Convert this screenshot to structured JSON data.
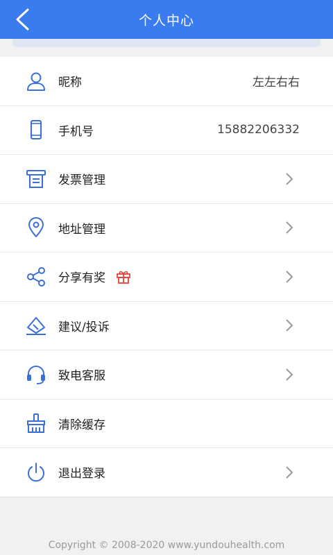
{
  "header": {
    "title": "个人中心"
  },
  "rows": [
    {
      "label": "昵称",
      "value": "左左右右"
    },
    {
      "label": "手机号",
      "value": "15882206332"
    },
    {
      "label": "发票管理"
    },
    {
      "label": "地址管理"
    },
    {
      "label": "分享有奖"
    },
    {
      "label": "建议/投诉"
    },
    {
      "label": "致电客服"
    },
    {
      "label": "清除缓存"
    },
    {
      "label": "退出登录"
    }
  ],
  "footer": {
    "copyright": "Copyright © 2008-2020 www.yundouhealth.com"
  },
  "colors": {
    "accent": "#3a7cf0",
    "icon": "#3a6fd8",
    "gift": "#e8403a"
  }
}
